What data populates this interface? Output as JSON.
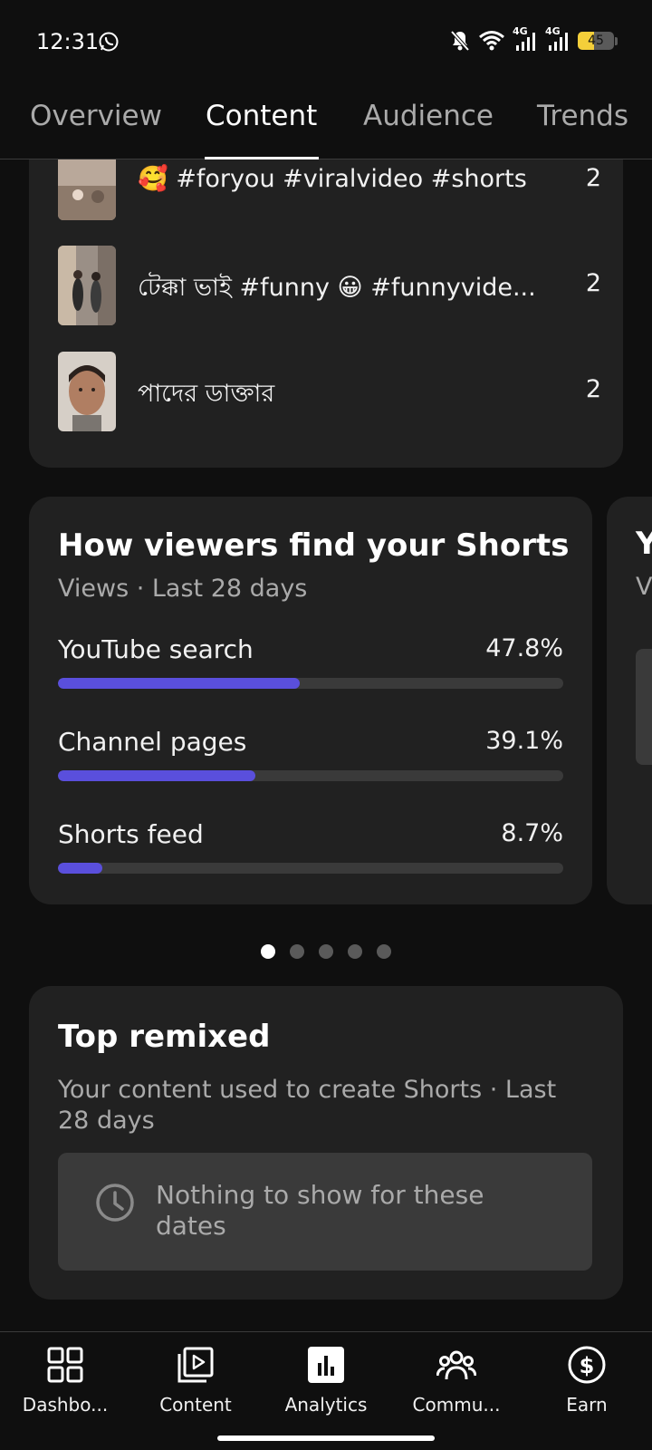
{
  "status_bar": {
    "time": "12:31",
    "battery": "45",
    "battery_level_percent": 45,
    "network_1": "4G",
    "network_2": "4G"
  },
  "tabs": [
    {
      "label": "Overview",
      "active": false
    },
    {
      "label": "Content",
      "active": true
    },
    {
      "label": "Audience",
      "active": false
    },
    {
      "label": "Trends",
      "active": false
    }
  ],
  "top_videos": [
    {
      "title": "🥰 #foryou #viralvideo #shorts",
      "count": "2"
    },
    {
      "title": "টেক্কা ভাই #funny 😀 #funnyvide...",
      "count": "2"
    },
    {
      "title": "পাদের ডাক্তার",
      "count": "2"
    }
  ],
  "traffic_card": {
    "title": "How viewers find your Shorts",
    "subtitle": "Views · Last 28 days",
    "sources": [
      {
        "label": "YouTube search",
        "value": "47.8%",
        "percent": 47.8
      },
      {
        "label": "Channel pages",
        "value": "39.1%",
        "percent": 39.1
      },
      {
        "label": "Shorts feed",
        "value": "8.7%",
        "percent": 8.7
      }
    ],
    "bar_color": "#5a4fdc"
  },
  "next_card_peek": {
    "title_fragment": "Y",
    "subtitle_fragment": "V"
  },
  "pagination": {
    "total": 5,
    "active_index": 0
  },
  "top_remixed": {
    "title": "Top remixed",
    "subtitle": "Your content used to create Shorts · Last 28 days",
    "empty_message": "Nothing to show for these dates",
    "icon": "clock-icon"
  },
  "bottom_nav": [
    {
      "label": "Dashbo...",
      "icon": "dashboard-icon"
    },
    {
      "label": "Content",
      "icon": "content-icon"
    },
    {
      "label": "Analytics",
      "icon": "analytics-icon"
    },
    {
      "label": "Commu...",
      "icon": "community-icon"
    },
    {
      "label": "Earn",
      "icon": "earn-icon"
    }
  ]
}
